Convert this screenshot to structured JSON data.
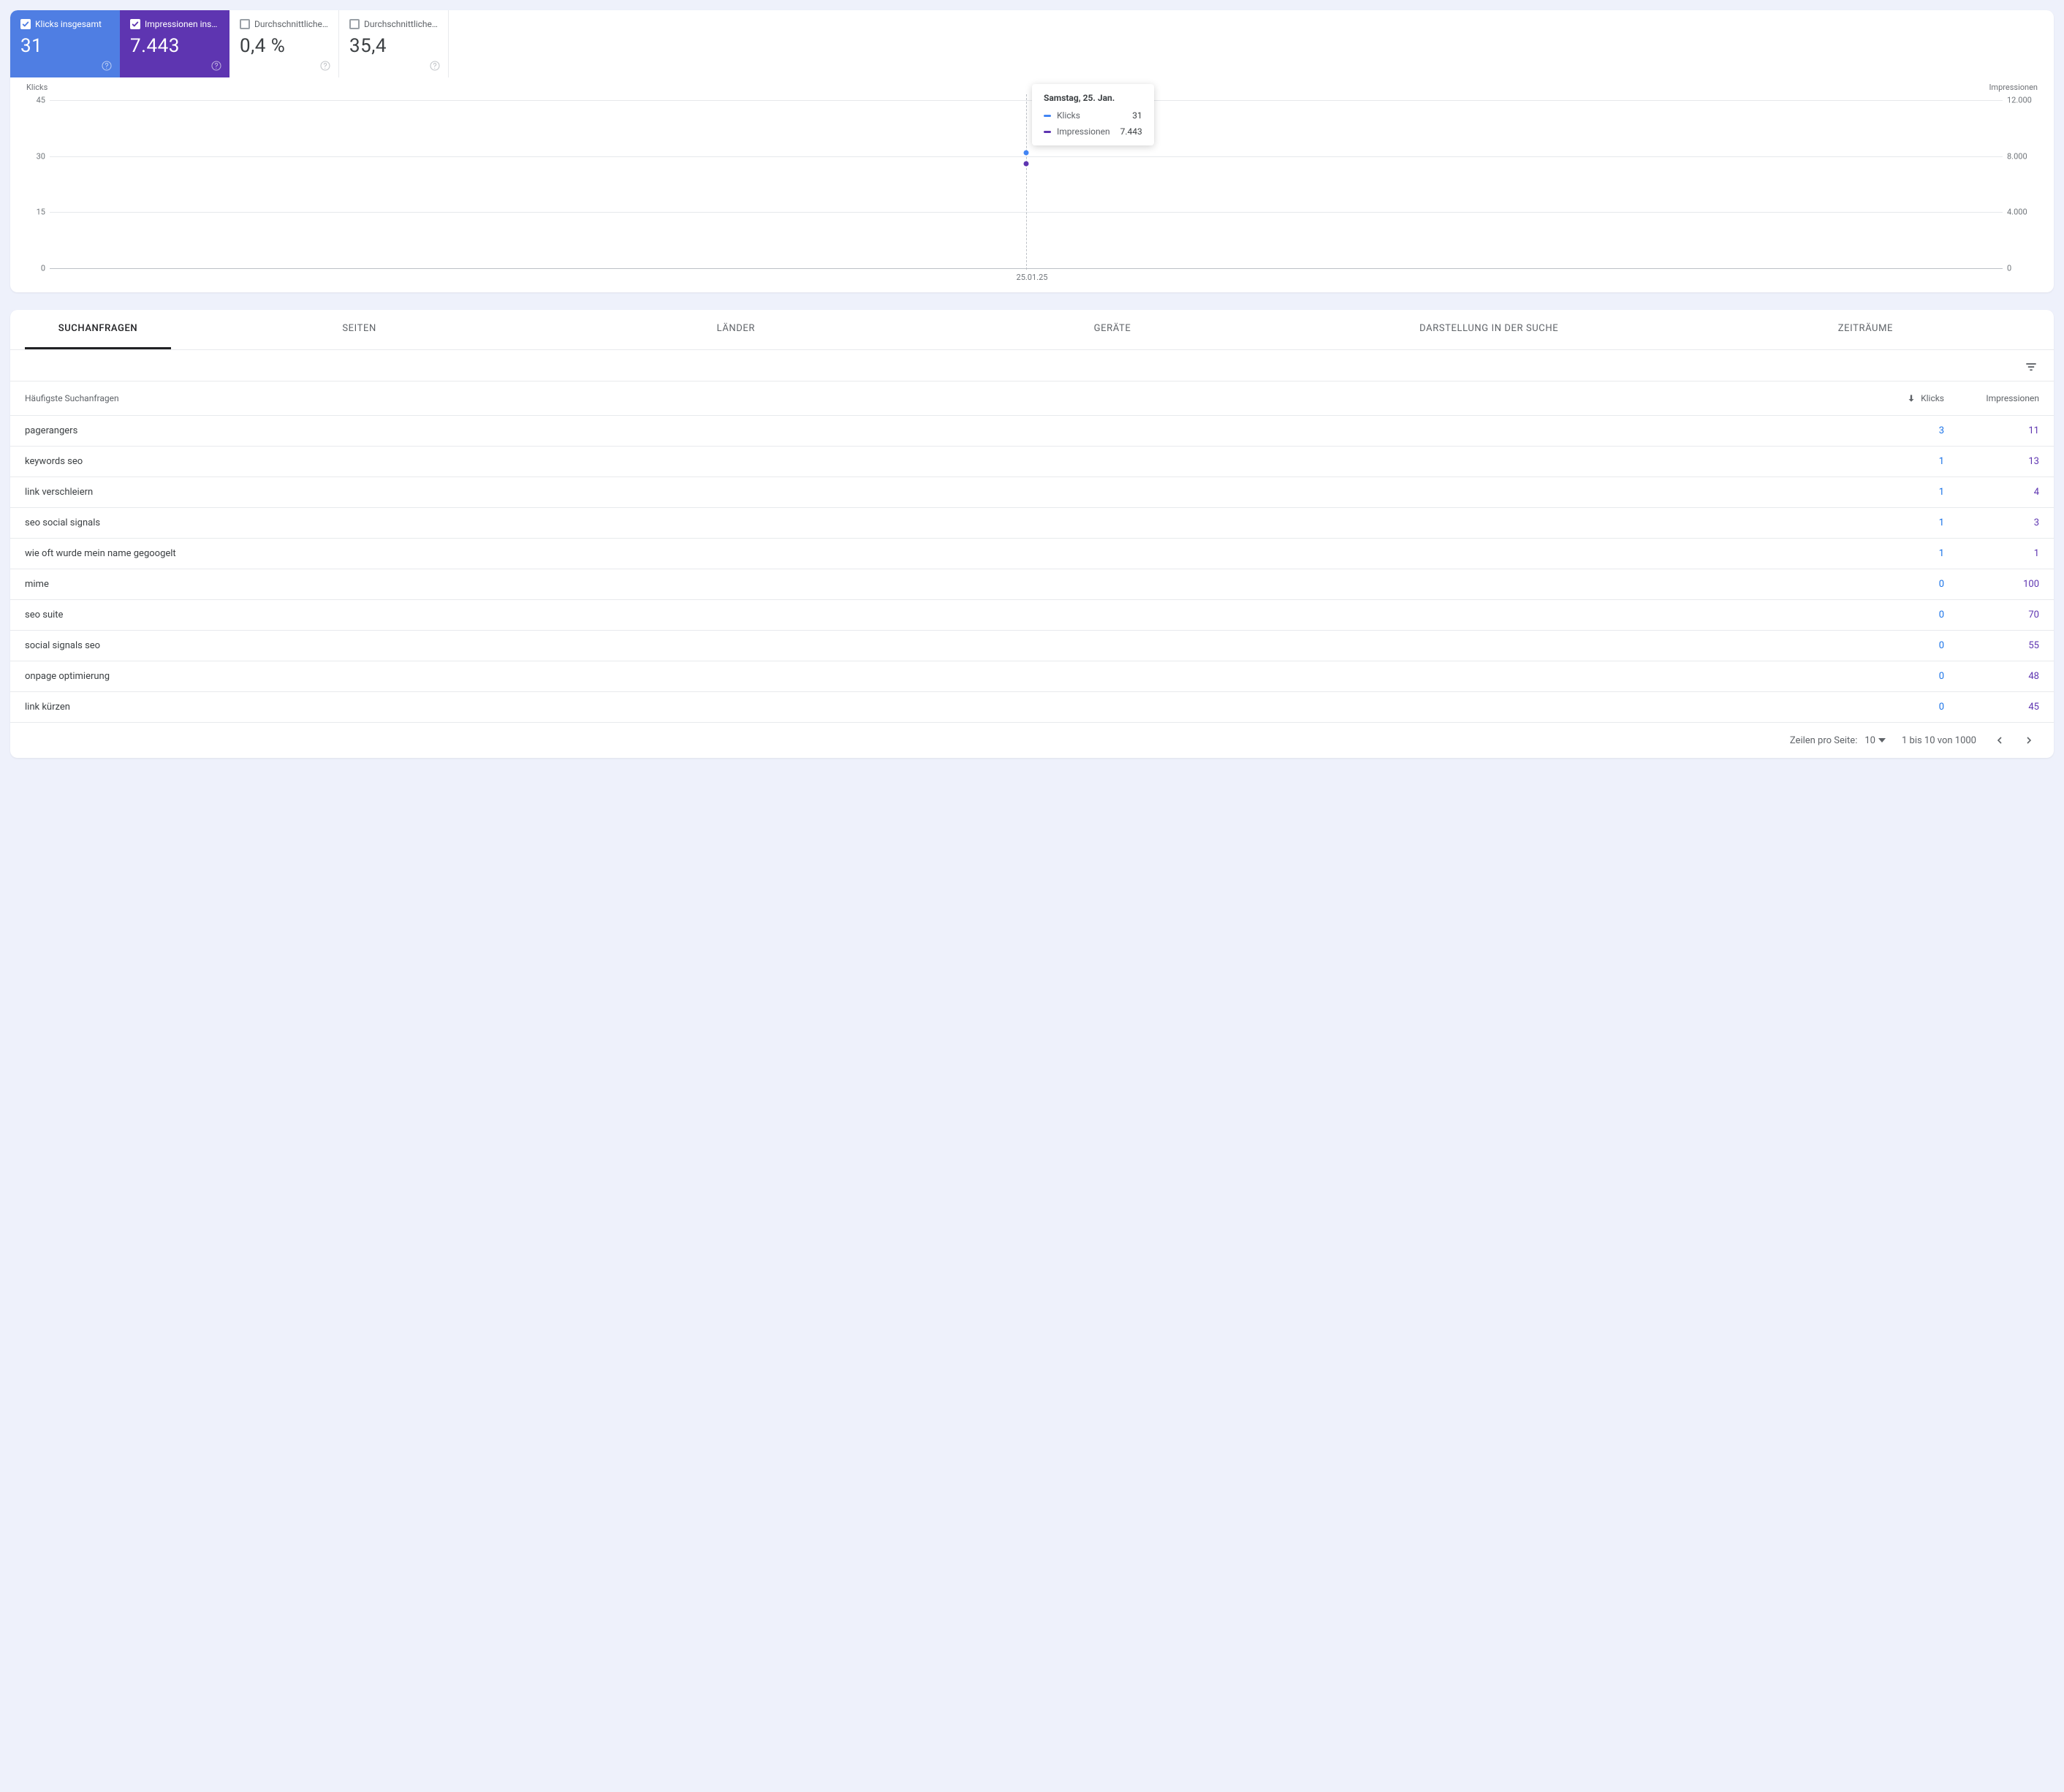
{
  "metrics": [
    {
      "label": "Klicks insgesamt",
      "value": "31"
    },
    {
      "label": "Impressionen ins…",
      "value": "7.443"
    },
    {
      "label": "Durchschnittliche…",
      "value": "0,4 %"
    },
    {
      "label": "Durchschnittliche…",
      "value": "35,4"
    }
  ],
  "chart": {
    "left_axis_title": "Klicks",
    "right_axis_title": "Impressionen",
    "x_label": "25.01.25"
  },
  "tooltip": {
    "title": "Samstag, 25. Jan.",
    "rows": [
      {
        "label": "Klicks",
        "value": "31"
      },
      {
        "label": "Impressionen",
        "value": "7.443"
      }
    ]
  },
  "chart_data": {
    "type": "line",
    "x": [
      "25.01.25"
    ],
    "series": [
      {
        "name": "Klicks",
        "values": [
          31
        ],
        "yaxis": "left"
      },
      {
        "name": "Impressionen",
        "values": [
          7443
        ],
        "yaxis": "right"
      }
    ],
    "left_axis": {
      "label": "Klicks",
      "ticks": [
        0,
        15,
        30,
        45
      ],
      "ylim": [
        0,
        45
      ]
    },
    "right_axis": {
      "label": "Impressionen",
      "ticks": [
        0,
        4000,
        8000,
        12000
      ],
      "ylim": [
        0,
        12000
      ]
    },
    "left_tick_labels": [
      "0",
      "15",
      "30",
      "45"
    ],
    "right_tick_labels": [
      "0",
      "4.000",
      "8.000",
      "12.000"
    ]
  },
  "tabs": [
    "SUCHANFRAGEN",
    "SEITEN",
    "LÄNDER",
    "GERÄTE",
    "DARSTELLUNG IN DER SUCHE",
    "ZEITRÄUME"
  ],
  "table": {
    "header_query": "Häufigste Suchanfragen",
    "header_clicks": "Klicks",
    "header_impr": "Impressionen",
    "rows": [
      {
        "q": "pagerangers",
        "k": "3",
        "i": "11"
      },
      {
        "q": "keywords seo",
        "k": "1",
        "i": "13"
      },
      {
        "q": "link verschleiern",
        "k": "1",
        "i": "4"
      },
      {
        "q": "seo social signals",
        "k": "1",
        "i": "3"
      },
      {
        "q": "wie oft wurde mein name gegoogelt",
        "k": "1",
        "i": "1"
      },
      {
        "q": "mime",
        "k": "0",
        "i": "100"
      },
      {
        "q": "seo suite",
        "k": "0",
        "i": "70"
      },
      {
        "q": "social signals seo",
        "k": "0",
        "i": "55"
      },
      {
        "q": "onpage optimierung",
        "k": "0",
        "i": "48"
      },
      {
        "q": "link kürzen",
        "k": "0",
        "i": "45"
      }
    ]
  },
  "pager": {
    "rows_label": "Zeilen pro Seite:",
    "rows_value": "10",
    "range": "1 bis 10 von 1000"
  }
}
